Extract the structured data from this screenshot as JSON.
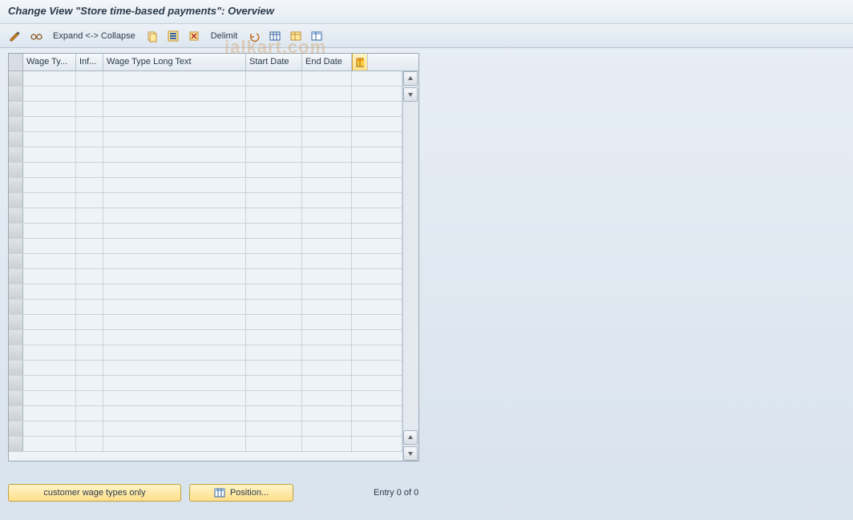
{
  "title": "Change View \"Store time-based payments\": Overview",
  "toolbar": {
    "expand_collapse_label": "Expand <-> Collapse",
    "delimit_label": "Delimit",
    "icons": {
      "pencil": "pencil-icon",
      "glasses": "glasses-icon",
      "copy": "copy-icon",
      "selectall": "select-all-icon",
      "deselect": "deselect-icon",
      "undo": "undo-icon",
      "tablecfg": "table-config-icon",
      "tablecfg2": "table-config-icon",
      "tablecfg3": "table-config-icon"
    }
  },
  "table": {
    "columns": {
      "wage_type": "Wage Ty...",
      "inf": "Inf...",
      "wage_type_long": "Wage Type Long Text",
      "start_date": "Start Date",
      "end_date": "End Date"
    },
    "rows": [
      {},
      {},
      {},
      {},
      {},
      {},
      {},
      {},
      {},
      {},
      {},
      {},
      {},
      {},
      {},
      {},
      {},
      {},
      {},
      {},
      {},
      {},
      {},
      {},
      {}
    ]
  },
  "footer": {
    "customer_btn": "customer wage types only",
    "position_btn": "Position...",
    "entry_text": "Entry 0 of 0"
  },
  "watermark": "ialkart.com"
}
